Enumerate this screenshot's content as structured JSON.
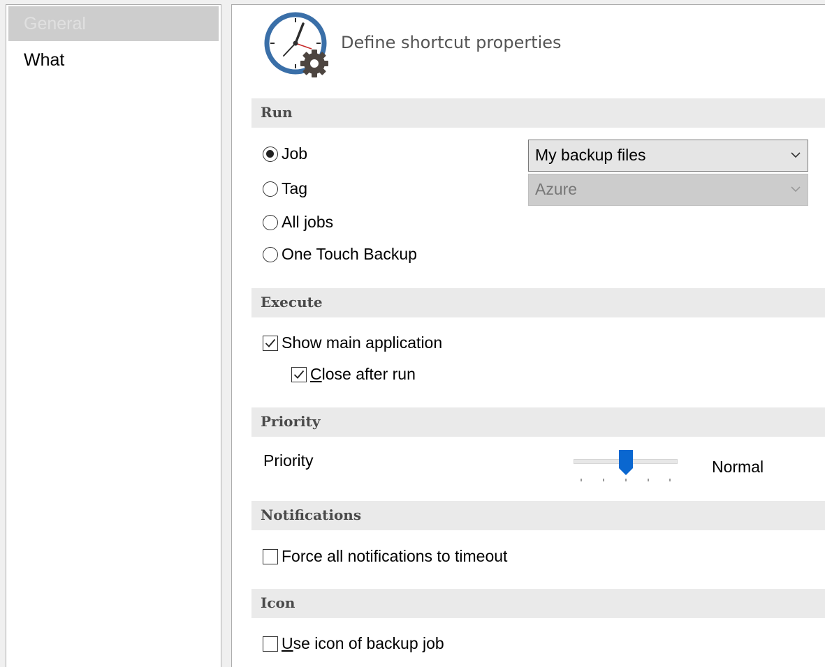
{
  "sidebar": {
    "items": [
      {
        "label": "General",
        "selected": true
      },
      {
        "label": "What",
        "selected": false
      }
    ]
  },
  "header": {
    "title": "Define shortcut properties",
    "icon": "clock-gear-icon"
  },
  "sections": {
    "run": "Run",
    "execute": "Execute",
    "priority": "Priority",
    "notifications": "Notifications",
    "icon": "Icon"
  },
  "run": {
    "options": [
      {
        "label": "Job",
        "checked": true
      },
      {
        "label": "Tag",
        "checked": false
      },
      {
        "label": "All jobs",
        "checked": false
      },
      {
        "label": "One Touch Backup",
        "checked": false
      }
    ],
    "job_select": {
      "value": "My backup files",
      "enabled": true
    },
    "tag_select": {
      "value": "Azure",
      "enabled": false
    }
  },
  "execute": {
    "show_main": {
      "label": "Show main application",
      "checked": true
    },
    "close_after": {
      "label_accel": "C",
      "label_rest": "lose after run",
      "checked": true
    }
  },
  "priority": {
    "label": "Priority",
    "value_label": "Normal",
    "level": 3,
    "levels": 5
  },
  "notifications": {
    "force_timeout": {
      "label": "Force all notifications to timeout",
      "checked": false
    }
  },
  "icon_section": {
    "use_job_icon": {
      "label_accel": "U",
      "label_rest": "se icon of backup job",
      "checked": false
    }
  },
  "colors": {
    "accent": "#0a67d0",
    "clock_ring": "#3a6fa8",
    "gear": "#4d4540"
  }
}
